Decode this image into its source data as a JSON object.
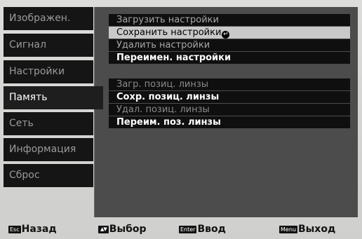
{
  "sidebar": {
    "items": [
      {
        "label": "Изображен."
      },
      {
        "label": "Сигнал"
      },
      {
        "label": "Настройки"
      },
      {
        "label": "Память"
      },
      {
        "label": "Сеть"
      },
      {
        "label": "Информация"
      },
      {
        "label": "Сброс"
      }
    ],
    "selected": "Память"
  },
  "panel": {
    "memory_group": [
      {
        "label": "Загрузить настройки"
      },
      {
        "label": "Сохранить настройки"
      },
      {
        "label": "Удалить настройки"
      },
      {
        "label": "Переимен. настройки"
      }
    ],
    "lens_group": [
      {
        "label": "Загр. позиц. линзы"
      },
      {
        "label": "Сохр. позиц. линзы"
      },
      {
        "label": "Удал. позиц. линзы"
      },
      {
        "label": "Переим. поз. линзы"
      }
    ],
    "enter_icon": "enter-arrow-icon"
  },
  "footer": {
    "back": {
      "key": "Esc",
      "label": "Назад"
    },
    "select": {
      "key": "▲▼",
      "label": "Выбор"
    },
    "enter": {
      "key": "Enter",
      "label": "Ввод"
    },
    "exit": {
      "key": "Menu",
      "label": "Выход"
    }
  },
  "colors": {
    "background": "#d2d2d0",
    "nav_item": "#151515",
    "panel": "#4c4c4c",
    "highlight": "#c9c9c9"
  }
}
